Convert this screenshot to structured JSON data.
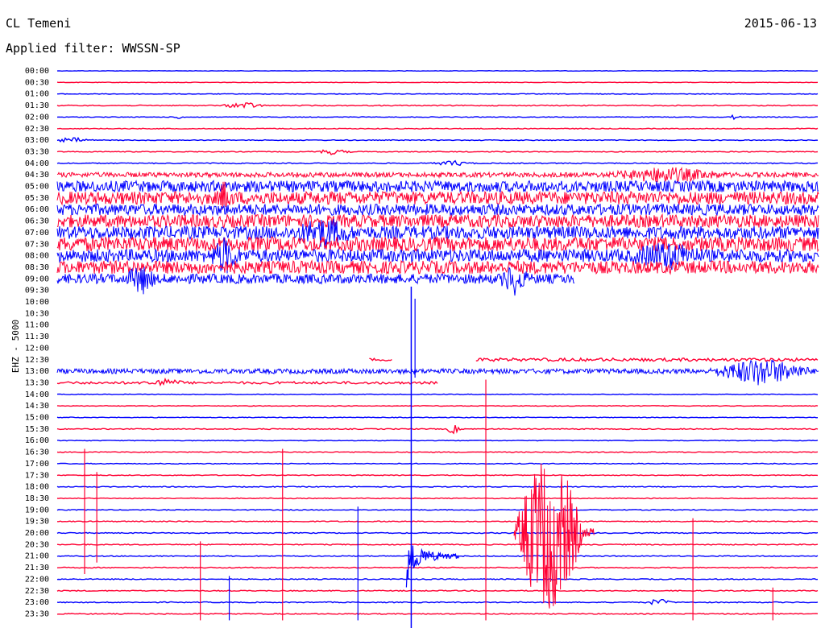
{
  "header": {
    "station": "CL Temeni",
    "date": "2015-06-13",
    "filter_label": "Applied filter:",
    "filter_value": "WWSSN-SP"
  },
  "channel_label": "EHZ - 5000",
  "colors": {
    "even_row": "#0000ff",
    "odd_row": "#ff0033"
  },
  "chart_data": {
    "type": "line",
    "title": "",
    "xlabel": "",
    "ylabel": "EHZ - 5000",
    "row_labels": [
      "00:00",
      "00:30",
      "01:00",
      "01:30",
      "02:00",
      "02:30",
      "03:00",
      "03:30",
      "04:00",
      "04:30",
      "05:00",
      "05:30",
      "06:00",
      "06:30",
      "07:00",
      "07:30",
      "08:00",
      "08:30",
      "09:00",
      "09:30",
      "10:00",
      "10:30",
      "11:00",
      "11:30",
      "12:00",
      "12:30",
      "13:00",
      "13:30",
      "14:00",
      "14:30",
      "15:00",
      "15:30",
      "16:00",
      "16:30",
      "17:00",
      "17:30",
      "18:00",
      "18:30",
      "19:00",
      "19:30",
      "20:00",
      "20:30",
      "21:00",
      "21:30",
      "22:00",
      "22:30",
      "23:00",
      "23:30"
    ],
    "row_minutes": 30,
    "rows": [
      {
        "t": "00:00",
        "start": 0,
        "end": 1,
        "noise": 0.3
      },
      {
        "t": "00:30",
        "start": 0,
        "end": 1,
        "noise": 0.3
      },
      {
        "t": "01:00",
        "start": 0,
        "end": 1,
        "noise": 0.4
      },
      {
        "t": "01:30",
        "start": 0,
        "end": 1,
        "noise": 0.6,
        "events": [
          {
            "x": 0.245,
            "amp": 4,
            "dur": 0.03,
            "kind": "burst"
          }
        ]
      },
      {
        "t": "02:00",
        "start": 0,
        "end": 1,
        "noise": 0.4,
        "events": [
          {
            "x": 0.16,
            "amp": 2,
            "dur": 0.01,
            "kind": "burst"
          },
          {
            "x": 0.89,
            "amp": 3,
            "dur": 0.01,
            "kind": "burst"
          }
        ]
      },
      {
        "t": "02:30",
        "start": 0,
        "end": 1,
        "noise": 0.5
      },
      {
        "t": "03:00",
        "start": 0,
        "end": 1,
        "noise": 0.5,
        "events": [
          {
            "x": 0.02,
            "amp": 3,
            "dur": 0.03,
            "kind": "burst"
          }
        ]
      },
      {
        "t": "03:30",
        "start": 0,
        "end": 1,
        "noise": 0.5,
        "events": [
          {
            "x": 0.36,
            "amp": 3,
            "dur": 0.03,
            "kind": "burst"
          }
        ]
      },
      {
        "t": "04:00",
        "start": 0,
        "end": 1,
        "noise": 0.6,
        "events": [
          {
            "x": 0.52,
            "amp": 3,
            "dur": 0.03,
            "kind": "burst"
          }
        ]
      },
      {
        "t": "04:30",
        "start": 0,
        "end": 1,
        "noise": 3,
        "events": [
          {
            "x": 0.8,
            "amp": 8,
            "dur": 0.08,
            "kind": "burst"
          }
        ]
      },
      {
        "t": "05:00",
        "start": 0,
        "end": 1,
        "noise": 7
      },
      {
        "t": "05:30",
        "start": 0,
        "end": 1,
        "noise": 8,
        "events": [
          {
            "x": 0.22,
            "amp": 16,
            "dur": 0.01,
            "kind": "spike"
          }
        ]
      },
      {
        "t": "06:00",
        "start": 0,
        "end": 1,
        "noise": 7
      },
      {
        "t": "06:30",
        "start": 0,
        "end": 1,
        "noise": 8
      },
      {
        "t": "07:00",
        "start": 0,
        "end": 1,
        "noise": 8,
        "events": [
          {
            "x": 0.35,
            "amp": 14,
            "dur": 0.04,
            "kind": "burst"
          }
        ]
      },
      {
        "t": "07:30",
        "start": 0,
        "end": 1,
        "noise": 9
      },
      {
        "t": "08:00",
        "start": 0,
        "end": 1,
        "noise": 8,
        "events": [
          {
            "x": 0.22,
            "amp": 18,
            "dur": 0.02,
            "kind": "burst"
          },
          {
            "x": 0.8,
            "amp": 12,
            "dur": 0.05,
            "kind": "burst"
          }
        ]
      },
      {
        "t": "08:30",
        "start": 0,
        "end": 1,
        "noise": 8
      },
      {
        "t": "09:00",
        "start": 0,
        "end": 0.68,
        "noise": 6,
        "events": [
          {
            "x": 0.11,
            "amp": 16,
            "dur": 0.02,
            "kind": "burst"
          },
          {
            "x": 0.6,
            "amp": 16,
            "dur": 0.02,
            "kind": "burst"
          }
        ]
      },
      {
        "t": "09:30",
        "start": 0,
        "end": 0,
        "noise": 0
      },
      {
        "t": "10:00",
        "start": 0,
        "end": 0,
        "noise": 0
      },
      {
        "t": "10:30",
        "start": 0,
        "end": 0,
        "noise": 0
      },
      {
        "t": "11:00",
        "start": 0,
        "end": 0,
        "noise": 0
      },
      {
        "t": "11:30",
        "start": 0,
        "end": 0,
        "noise": 0
      },
      {
        "t": "12:00",
        "start": 0,
        "end": 0,
        "noise": 0
      },
      {
        "t": "12:30",
        "start": 0.41,
        "end": 0.44,
        "noise": 2,
        "segments": [
          [
            0.41,
            0.44
          ],
          [
            0.55,
            1.0
          ]
        ]
      },
      {
        "t": "13:00",
        "start": 0,
        "end": 1,
        "noise": 3,
        "events": [
          {
            "x": 0.925,
            "amp": 16,
            "dur": 0.07,
            "kind": "burst"
          }
        ]
      },
      {
        "t": "13:30",
        "start": 0,
        "end": 0.5,
        "noise": 1.5,
        "events": [
          {
            "x": 0.14,
            "amp": 4,
            "dur": 0.03,
            "kind": "burst"
          }
        ]
      },
      {
        "t": "14:00",
        "start": 0,
        "end": 1,
        "noise": 0.4
      },
      {
        "t": "14:30",
        "start": 0,
        "end": 1,
        "noise": 0.4
      },
      {
        "t": "15:00",
        "start": 0,
        "end": 1,
        "noise": 0.4
      },
      {
        "t": "15:30",
        "start": 0,
        "end": 1,
        "noise": 0.6,
        "events": [
          {
            "x": 0.52,
            "amp": 6,
            "dur": 0.01,
            "kind": "burst"
          }
        ]
      },
      {
        "t": "16:00",
        "start": 0,
        "end": 1,
        "noise": 0.4
      },
      {
        "t": "16:30",
        "start": 0,
        "end": 1,
        "noise": 0.5
      },
      {
        "t": "17:00",
        "start": 0,
        "end": 1,
        "noise": 0.5
      },
      {
        "t": "17:30",
        "start": 0,
        "end": 1,
        "noise": 0.5
      },
      {
        "t": "18:00",
        "start": 0,
        "end": 1,
        "noise": 0.5
      },
      {
        "t": "18:30",
        "start": 0,
        "end": 1,
        "noise": 0.5
      },
      {
        "t": "19:00",
        "start": 0,
        "end": 1,
        "noise": 0.5
      },
      {
        "t": "19:30",
        "start": 0,
        "end": 1,
        "noise": 0.6
      },
      {
        "t": "20:00",
        "start": 0,
        "end": 1,
        "noise": 0.6
      },
      {
        "t": "20:30",
        "start": 0,
        "end": 1,
        "noise": 0.6
      },
      {
        "t": "21:00",
        "start": 0,
        "end": 1,
        "noise": 0.6
      },
      {
        "t": "21:30",
        "start": 0,
        "end": 1,
        "noise": 0.6
      },
      {
        "t": "22:00",
        "start": 0,
        "end": 1,
        "noise": 0.6
      },
      {
        "t": "22:30",
        "start": 0,
        "end": 1,
        "noise": 0.6
      },
      {
        "t": "23:00",
        "start": 0,
        "end": 1,
        "noise": 0.6,
        "events": [
          {
            "x": 0.79,
            "amp": 4,
            "dur": 0.02,
            "kind": "burst"
          }
        ]
      },
      {
        "t": "23:30",
        "start": 0,
        "end": 1,
        "noise": 0.6
      }
    ],
    "earthquakes": [
      {
        "x": 0.465,
        "row_start": 19,
        "row_end": 47,
        "amp": 120,
        "note": "large teleseism with coda around 21:00"
      },
      {
        "x": 0.62,
        "row_start": 38,
        "row_end": 45,
        "amp": 95,
        "note": "long-period red burst 19:30–22:00"
      }
    ],
    "spikes": [
      {
        "x": 0.036,
        "rows": [
          33,
          43
        ]
      },
      {
        "x": 0.052,
        "rows": [
          35,
          42
        ]
      },
      {
        "x": 0.188,
        "rows": [
          41,
          47
        ]
      },
      {
        "x": 0.226,
        "rows": [
          44,
          47
        ]
      },
      {
        "x": 0.296,
        "rows": [
          33,
          47
        ]
      },
      {
        "x": 0.395,
        "rows": [
          38,
          47
        ]
      },
      {
        "x": 0.563,
        "rows": [
          27,
          47
        ]
      },
      {
        "x": 0.835,
        "rows": [
          39,
          47
        ]
      },
      {
        "x": 0.94,
        "rows": [
          45,
          47
        ]
      },
      {
        "x": 0.47,
        "rows": [
          20,
          26
        ]
      }
    ]
  }
}
